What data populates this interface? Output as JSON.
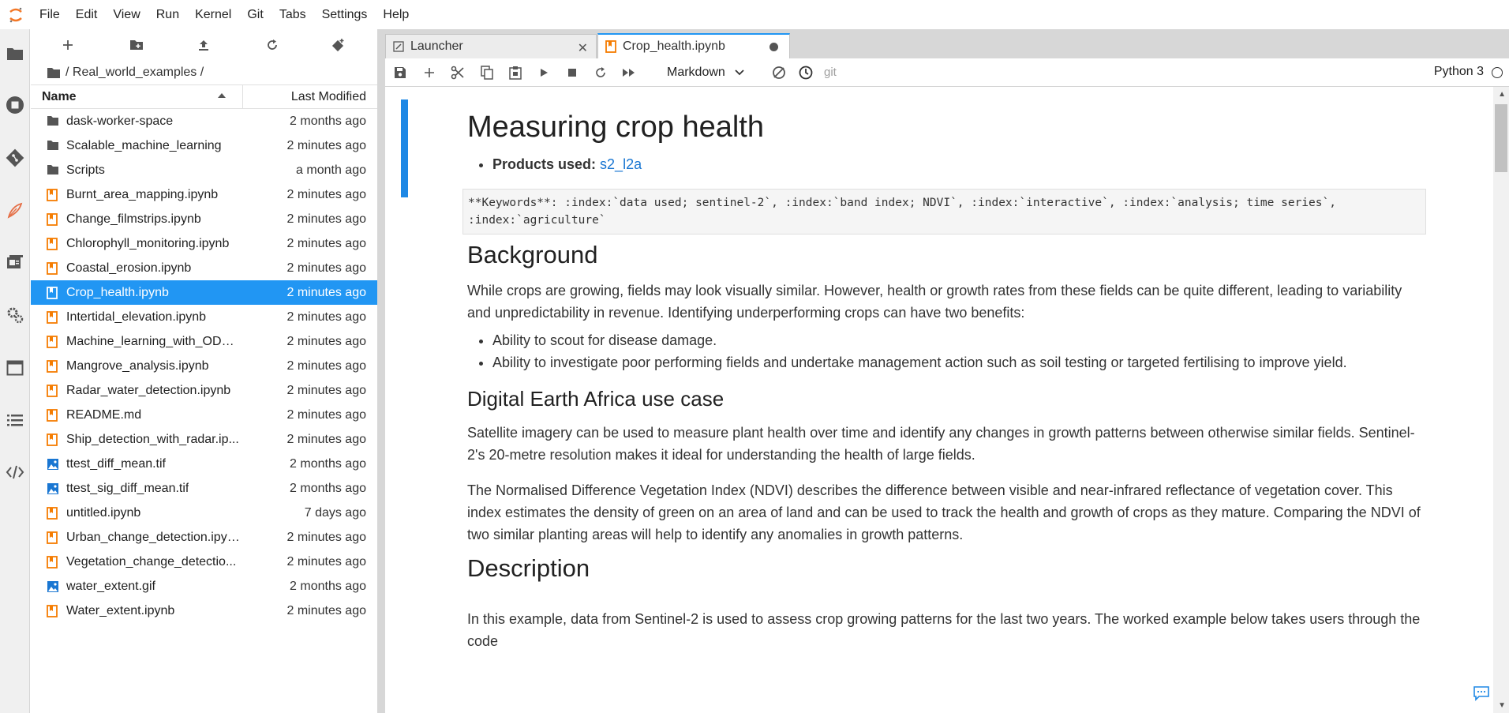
{
  "menubar": {
    "items": [
      "File",
      "Edit",
      "View",
      "Run",
      "Kernel",
      "Git",
      "Tabs",
      "Settings",
      "Help"
    ]
  },
  "filebrowser": {
    "breadcrumb": "/ Real_world_examples /",
    "header": {
      "name": "Name",
      "modified": "Last Modified"
    },
    "files": [
      {
        "name": "dask-worker-space",
        "modified": "2 months ago",
        "type": "folder"
      },
      {
        "name": "Scalable_machine_learning",
        "modified": "2 minutes ago",
        "type": "folder"
      },
      {
        "name": "Scripts",
        "modified": "a month ago",
        "type": "folder"
      },
      {
        "name": "Burnt_area_mapping.ipynb",
        "modified": "2 minutes ago",
        "type": "notebook"
      },
      {
        "name": "Change_filmstrips.ipynb",
        "modified": "2 minutes ago",
        "type": "notebook"
      },
      {
        "name": "Chlorophyll_monitoring.ipynb",
        "modified": "2 minutes ago",
        "type": "notebook"
      },
      {
        "name": "Coastal_erosion.ipynb",
        "modified": "2 minutes ago",
        "type": "notebook"
      },
      {
        "name": "Crop_health.ipynb",
        "modified": "2 minutes ago",
        "type": "notebook",
        "selected": true
      },
      {
        "name": "Intertidal_elevation.ipynb",
        "modified": "2 minutes ago",
        "type": "notebook"
      },
      {
        "name": "Machine_learning_with_ODC....",
        "modified": "2 minutes ago",
        "type": "notebook"
      },
      {
        "name": "Mangrove_analysis.ipynb",
        "modified": "2 minutes ago",
        "type": "notebook"
      },
      {
        "name": "Radar_water_detection.ipynb",
        "modified": "2 minutes ago",
        "type": "notebook"
      },
      {
        "name": "README.md",
        "modified": "2 minutes ago",
        "type": "notebook"
      },
      {
        "name": "Ship_detection_with_radar.ip...",
        "modified": "2 minutes ago",
        "type": "notebook"
      },
      {
        "name": "ttest_diff_mean.tif",
        "modified": "2 months ago",
        "type": "image"
      },
      {
        "name": "ttest_sig_diff_mean.tif",
        "modified": "2 months ago",
        "type": "image"
      },
      {
        "name": "untitled.ipynb",
        "modified": "7 days ago",
        "type": "notebook"
      },
      {
        "name": "Urban_change_detection.ipynb",
        "modified": "2 minutes ago",
        "type": "notebook"
      },
      {
        "name": "Vegetation_change_detectio...",
        "modified": "2 minutes ago",
        "type": "notebook"
      },
      {
        "name": "water_extent.gif",
        "modified": "2 months ago",
        "type": "image"
      },
      {
        "name": "Water_extent.ipynb",
        "modified": "2 minutes ago",
        "type": "notebook"
      }
    ]
  },
  "tabs": [
    {
      "label": "Launcher",
      "active": false
    },
    {
      "label": "Crop_health.ipynb",
      "active": true
    }
  ],
  "notebook_toolbar": {
    "cell_type": "Markdown",
    "git": "git",
    "kernel": "Python 3"
  },
  "notebook": {
    "title": "Measuring crop health",
    "products_label": "Products used:",
    "products_link": "s2_l2a",
    "keywords_line1": "**Keywords**: :index:`data used; sentinel-2`, :index:`band index; NDVI`, :index:`interactive`, :index:`analysis; time series`,",
    "keywords_line2": ":index:`agriculture`",
    "background_heading": "Background",
    "background_p": "While crops are growing, fields may look visually similar. However, health or growth rates from these fields can be quite different, leading to variability and unpredictability in revenue. Identifying underperforming crops can have two benefits:",
    "benefit1": "Ability to scout for disease damage.",
    "benefit2": "Ability to investigate poor performing fields and undertake management action such as soil testing or targeted fertilising to improve yield.",
    "usecase_heading": "Digital Earth Africa use case",
    "usecase_p1": "Satellite imagery can be used to measure plant health over time and identify any changes in growth patterns between otherwise similar fields. Sentinel-2's 20-metre resolution makes it ideal for understanding the health of large fields.",
    "usecase_p2": "The Normalised Difference Vegetation Index (NDVI) describes the difference between visible and near-infrared reflectance of vegetation cover. This index estimates the density of green on an area of land and can be used to track the health and growth of crops as they mature. Comparing the NDVI of two similar planting areas will help to identify any anomalies in growth patterns.",
    "description_heading": "Description",
    "description_p": "In this example, data from Sentinel-2 is used to assess crop growing patterns for the last two years. The worked example below takes users through the code"
  },
  "colors": {
    "accent": "#2196f3",
    "notebook_icon": "#f57c00",
    "image_icon": "#1976d2",
    "link": "#1976d2"
  }
}
